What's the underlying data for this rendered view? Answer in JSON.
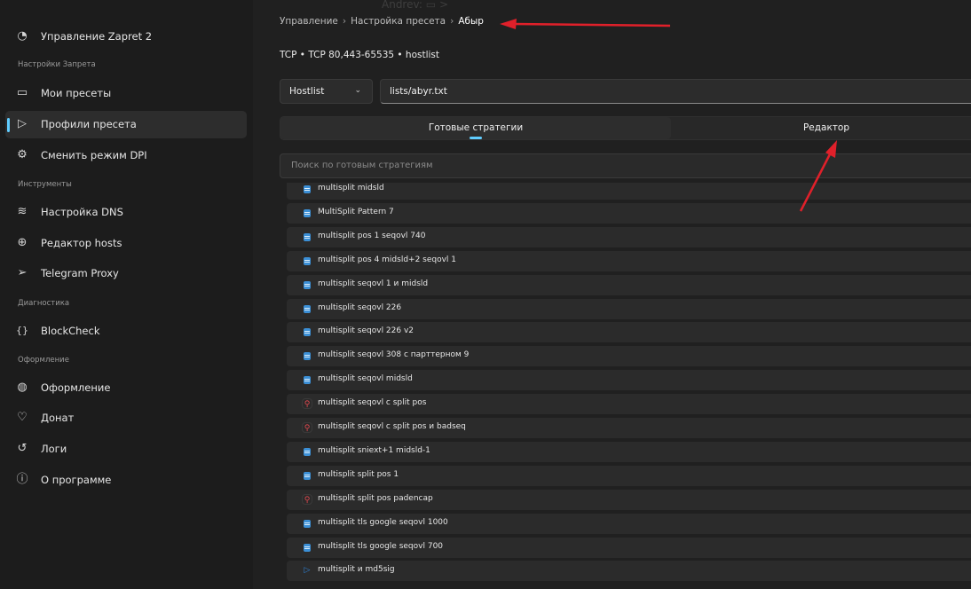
{
  "sidebar": {
    "app_item": {
      "label": "Управление Zapret 2",
      "icon": "controller-icon"
    },
    "sections": {
      "settings": "Настройки Запрета",
      "tools": "Инструменты",
      "diagnostics": "Диагностика",
      "appearance": "Оформление"
    },
    "items": [
      {
        "label": "Мои пресеты",
        "icon": "folder-icon"
      },
      {
        "label": "Профили пресета",
        "icon": "play-outline-icon"
      },
      {
        "label": "Сменить режим DPI",
        "icon": "gear-icon"
      },
      {
        "label": "Настройка DNS",
        "icon": "wifi-icon"
      },
      {
        "label": "Редактор hosts",
        "icon": "globe-icon"
      },
      {
        "label": "Telegram Proxy",
        "icon": "send-icon"
      },
      {
        "label": "BlockCheck",
        "icon": "braces-icon"
      },
      {
        "label": "Оформление",
        "icon": "palette-icon"
      },
      {
        "label": "Донат",
        "icon": "heart-icon"
      },
      {
        "label": "Логи",
        "icon": "history-icon"
      },
      {
        "label": "О программе",
        "icon": "info-icon"
      }
    ]
  },
  "header": {
    "ghost_title": "Andrev: ▭ >",
    "breadcrumb": [
      "Управление",
      "Настройка пресета",
      "Абыр"
    ],
    "breadcrumb_sep": "›",
    "subline": "TCP • TCP 80,443-65535 • hostlist"
  },
  "filter": {
    "type_value": "Hostlist",
    "path_value": "lists/abyr.txt"
  },
  "tabs": {
    "ready": "Готовые стратегии",
    "editor": "Редактор"
  },
  "search": {
    "placeholder": "Поиск по готовым стратегиям"
  },
  "strategies": [
    {
      "label": "multisplit midsld",
      "icon": "doc"
    },
    {
      "label": "MultiSplit Pattern 7",
      "icon": "doc"
    },
    {
      "label": "multisplit pos 1 seqovl 740",
      "icon": "doc"
    },
    {
      "label": "multisplit pos 4 midsld+2 seqovl 1",
      "icon": "doc"
    },
    {
      "label": "multisplit seqovl 1 и midsld",
      "icon": "doc"
    },
    {
      "label": "multisplit seqovl 226",
      "icon": "doc"
    },
    {
      "label": "multisplit seqovl 226 v2",
      "icon": "doc"
    },
    {
      "label": "multisplit seqovl 308 с парттерном 9",
      "icon": "doc"
    },
    {
      "label": "multisplit seqovl midsld",
      "icon": "doc"
    },
    {
      "label": "multisplit seqovl с split pos",
      "icon": "search"
    },
    {
      "label": "multisplit seqovl с split pos и badseq",
      "icon": "search"
    },
    {
      "label": "multisplit sniext+1 midsld-1",
      "icon": "doc"
    },
    {
      "label": "multisplit split pos 1",
      "icon": "doc"
    },
    {
      "label": "multisplit split pos padencap",
      "icon": "search"
    },
    {
      "label": "multisplit tls google seqovl 1000",
      "icon": "doc"
    },
    {
      "label": "multisplit tls google seqovl 700",
      "icon": "doc"
    },
    {
      "label": "multisplit и md5sig",
      "icon": "play"
    }
  ],
  "colors": {
    "accent": "#60cdff",
    "annotation_arrow": "#e0202a"
  }
}
